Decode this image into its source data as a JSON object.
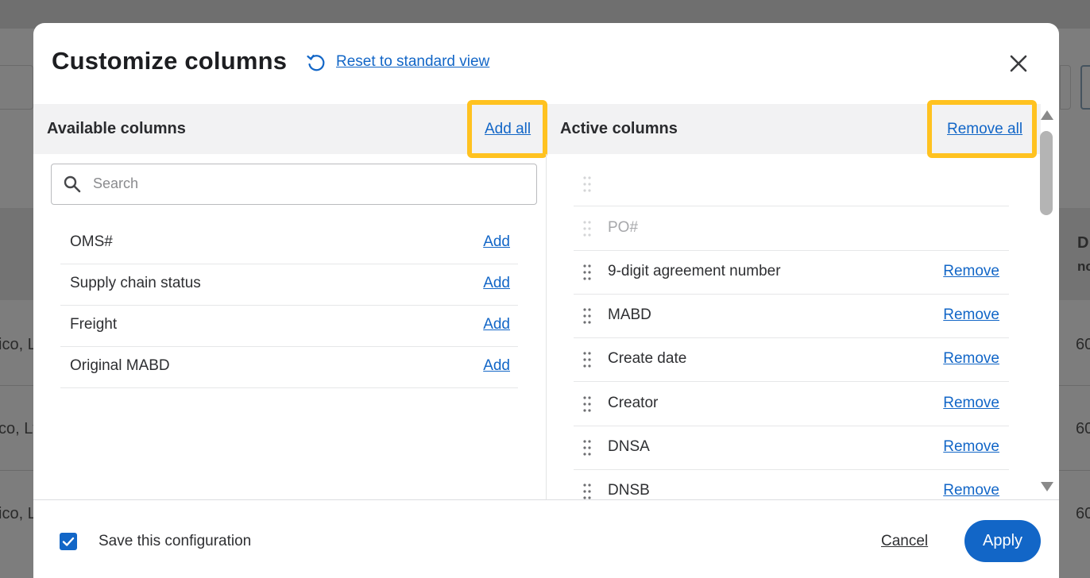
{
  "colors": {
    "accent": "#1266c7",
    "highlight": "#ffc220",
    "header_bg": "#f2f2f3",
    "overlay": "#7d7d7d"
  },
  "background_page": {
    "partial_texts": [
      "ico, L",
      "co, Lt",
      "ico, L",
      "60",
      "60",
      "60",
      "D",
      "nc"
    ]
  },
  "modal": {
    "title": "Customize columns",
    "reset_label": "Reset to standard view",
    "reset_icon": "reset-icon",
    "close_icon": "close-icon"
  },
  "available": {
    "title": "Available columns",
    "add_all_label": "Add all",
    "search": {
      "placeholder": "Search",
      "value": "",
      "icon": "search-icon"
    },
    "items": [
      {
        "label": "OMS#",
        "action": "Add"
      },
      {
        "label": "Supply chain status",
        "action": "Add"
      },
      {
        "label": "Freight",
        "action": "Add"
      },
      {
        "label": "Original MABD",
        "action": "Add"
      }
    ]
  },
  "active": {
    "title": "Active columns",
    "remove_all_label": "Remove all",
    "items": [
      {
        "label": "",
        "action": "",
        "locked": true
      },
      {
        "label": "PO#",
        "action": "",
        "locked": true
      },
      {
        "label": "9-digit agreement number",
        "action": "Remove",
        "locked": false
      },
      {
        "label": "MABD",
        "action": "Remove",
        "locked": false
      },
      {
        "label": "Create date",
        "action": "Remove",
        "locked": false
      },
      {
        "label": "Creator",
        "action": "Remove",
        "locked": false
      },
      {
        "label": "DNSA",
        "action": "Remove",
        "locked": false
      },
      {
        "label": "DNSB",
        "action": "Remove",
        "locked": false
      }
    ]
  },
  "footer": {
    "save_config_label": "Save this configuration",
    "save_config_checked": true,
    "cancel_label": "Cancel",
    "apply_label": "Apply"
  }
}
